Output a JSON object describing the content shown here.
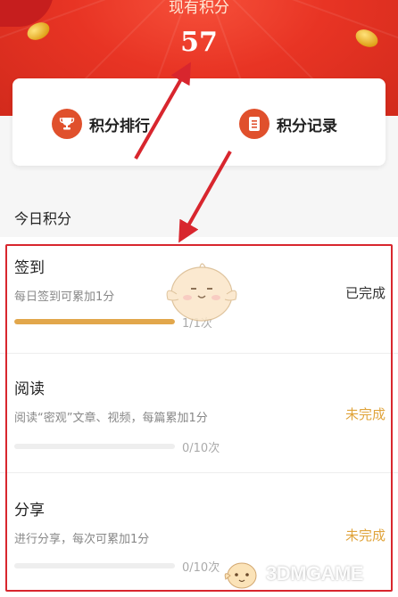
{
  "header": {
    "points_label": "现有积分",
    "points_value": "57"
  },
  "quick_actions": [
    {
      "label": "积分排行",
      "icon": "trophy-icon"
    },
    {
      "label": "积分记录",
      "icon": "document-icon"
    }
  ],
  "section": {
    "title": "今日积分"
  },
  "tasks": [
    {
      "name": "签到",
      "description": "每日签到可累加1分",
      "status": "已完成",
      "progress_text": "1/1次",
      "progress": 1.0
    },
    {
      "name": "阅读",
      "description": "阅读“密观”文章、视频，每篇累加1分",
      "status": "未完成",
      "progress_text": "0/10次",
      "progress": 0.0
    },
    {
      "name": "分享",
      "description": "进行分享，每次可累加1分",
      "status": "未完成",
      "progress_text": "0/10次",
      "progress": 0.0
    }
  ],
  "watermark": {
    "text": "3DMGAME"
  },
  "colors": {
    "header_red": "#e83424",
    "icon_orange": "#e0502c",
    "progress_fill": "#e2a74b",
    "status_done": "#333333",
    "status_pending": "#e0a43c",
    "annotation_red": "#d8262e"
  }
}
